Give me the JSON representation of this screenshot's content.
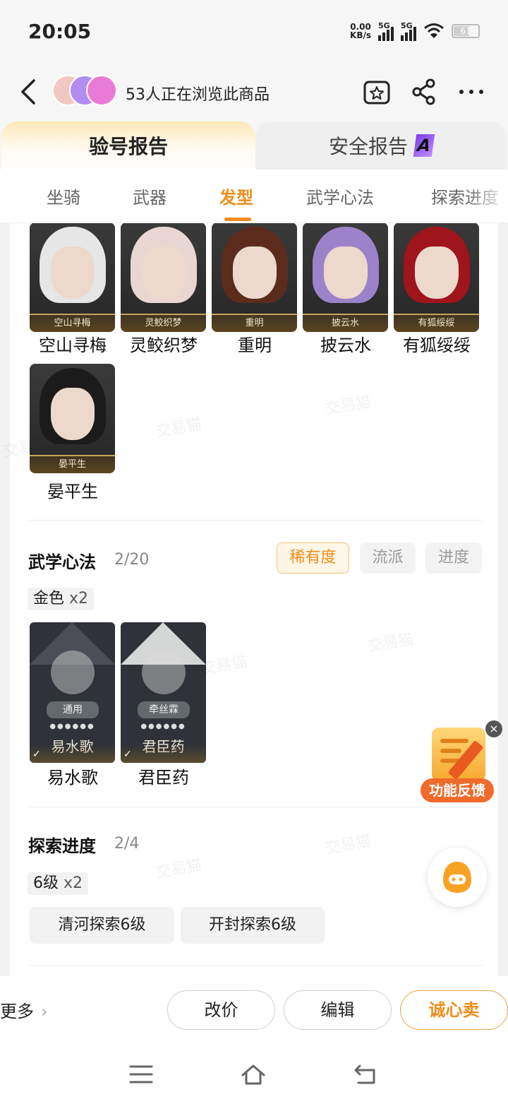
{
  "status_bar": {
    "time": "20:05",
    "net_speed_value": "0.00",
    "net_speed_unit": "KB/s",
    "sim1": "5G",
    "sim2": "5G",
    "battery": "61"
  },
  "header": {
    "viewers_text": "53人正在浏览此商品",
    "avatar_colors": [
      "#f3c7c1",
      "#b38cf0",
      "#e97ad6"
    ]
  },
  "report_tabs": {
    "active": "验号报告",
    "inactive": "安全报告",
    "badge": "A"
  },
  "category_tabs": [
    "坐骑",
    "武器",
    "发型",
    "武学心法",
    "探索进度"
  ],
  "hairstyles": [
    {
      "name": "空山寻梅",
      "hair_color": "#e6e6e6"
    },
    {
      "name": "灵鲛织梦",
      "hair_color": "#e8d6d3"
    },
    {
      "name": "重明",
      "hair_color": "#5b2c1c"
    },
    {
      "name": "披云水",
      "hair_color": "#9b83c9"
    },
    {
      "name": "有狐绥绥",
      "hair_color": "#a0141c"
    },
    {
      "name": "晏平生",
      "hair_color": "#1b1b1b"
    }
  ],
  "martial": {
    "title": "武学心法",
    "count": "2/20",
    "filters": [
      "稀有度",
      "流派",
      "进度"
    ],
    "chip_label": "金色",
    "chip_mult": "x2",
    "skills": [
      {
        "name": "易水歌",
        "tag": "通用"
      },
      {
        "name": "君臣药",
        "tag": "牵丝霖"
      }
    ]
  },
  "explore": {
    "title": "探索进度",
    "count": "2/4",
    "chip_label": "6级",
    "chip_mult": "x2",
    "items": [
      "清河探索6级",
      "开封探索6级"
    ]
  },
  "watermark": "交易猫",
  "feedback": {
    "label": "功能反馈",
    "close": "×"
  },
  "bottom_bar": {
    "more": "更多",
    "more_chevron": "›",
    "buttons": [
      "改价",
      "编辑",
      "诚心卖"
    ]
  },
  "colors": {
    "accent": "#f08c1a",
    "page_bg": "#f2f2f2"
  }
}
